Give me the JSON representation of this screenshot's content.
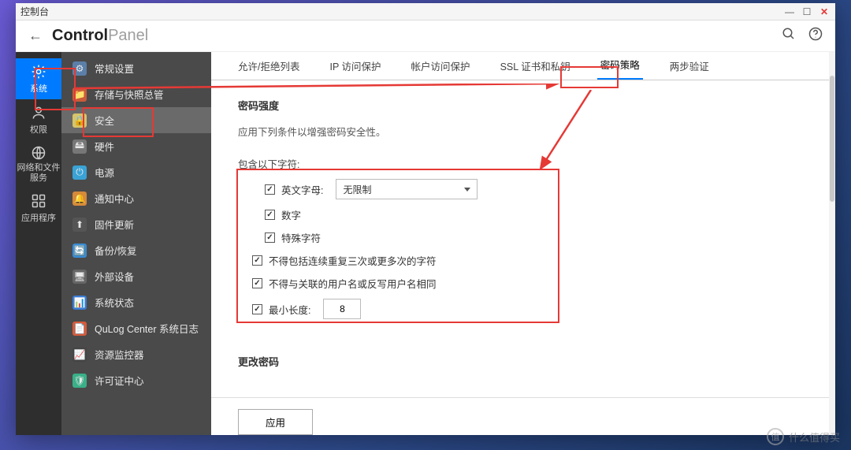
{
  "window": {
    "title": "控制台"
  },
  "header": {
    "brand_bold": "Control",
    "brand_light": "Panel"
  },
  "rail": [
    {
      "label": "系统"
    },
    {
      "label": "权限"
    },
    {
      "label": "网络和文件\n服务"
    },
    {
      "label": "应用程序"
    }
  ],
  "nav": [
    {
      "label": "常规设置"
    },
    {
      "label": "存储与快照总管"
    },
    {
      "label": "安全"
    },
    {
      "label": "硬件"
    },
    {
      "label": "电源"
    },
    {
      "label": "通知中心"
    },
    {
      "label": "固件更新"
    },
    {
      "label": "备份/恢复"
    },
    {
      "label": "外部设备"
    },
    {
      "label": "系统状态"
    },
    {
      "label": "QuLog Center 系统日志"
    },
    {
      "label": "资源监控器"
    },
    {
      "label": "许可证中心"
    }
  ],
  "tabs": [
    {
      "label": "允许/拒绝列表"
    },
    {
      "label": "IP 访问保护"
    },
    {
      "label": "帐户访问保护"
    },
    {
      "label": "SSL 证书和私钥"
    },
    {
      "label": "密码策略"
    },
    {
      "label": "两步验证"
    }
  ],
  "pane": {
    "section_title": "密码强度",
    "section_desc": "应用下列条件以增强密码安全性。",
    "include_label": "包含以下字符:",
    "chk_letters": "英文字母:",
    "letters_select": "无限制",
    "chk_digits": "数字",
    "chk_special": "特殊字符",
    "chk_no_repeat": "不得包括连续重复三次或更多次的字符",
    "chk_no_username": "不得与关联的用户名或反写用户名相同",
    "chk_min_len": "最小长度:",
    "min_len_value": "8",
    "change_pw_title": "更改密码",
    "apply": "应用"
  },
  "watermark": "什么值得买"
}
